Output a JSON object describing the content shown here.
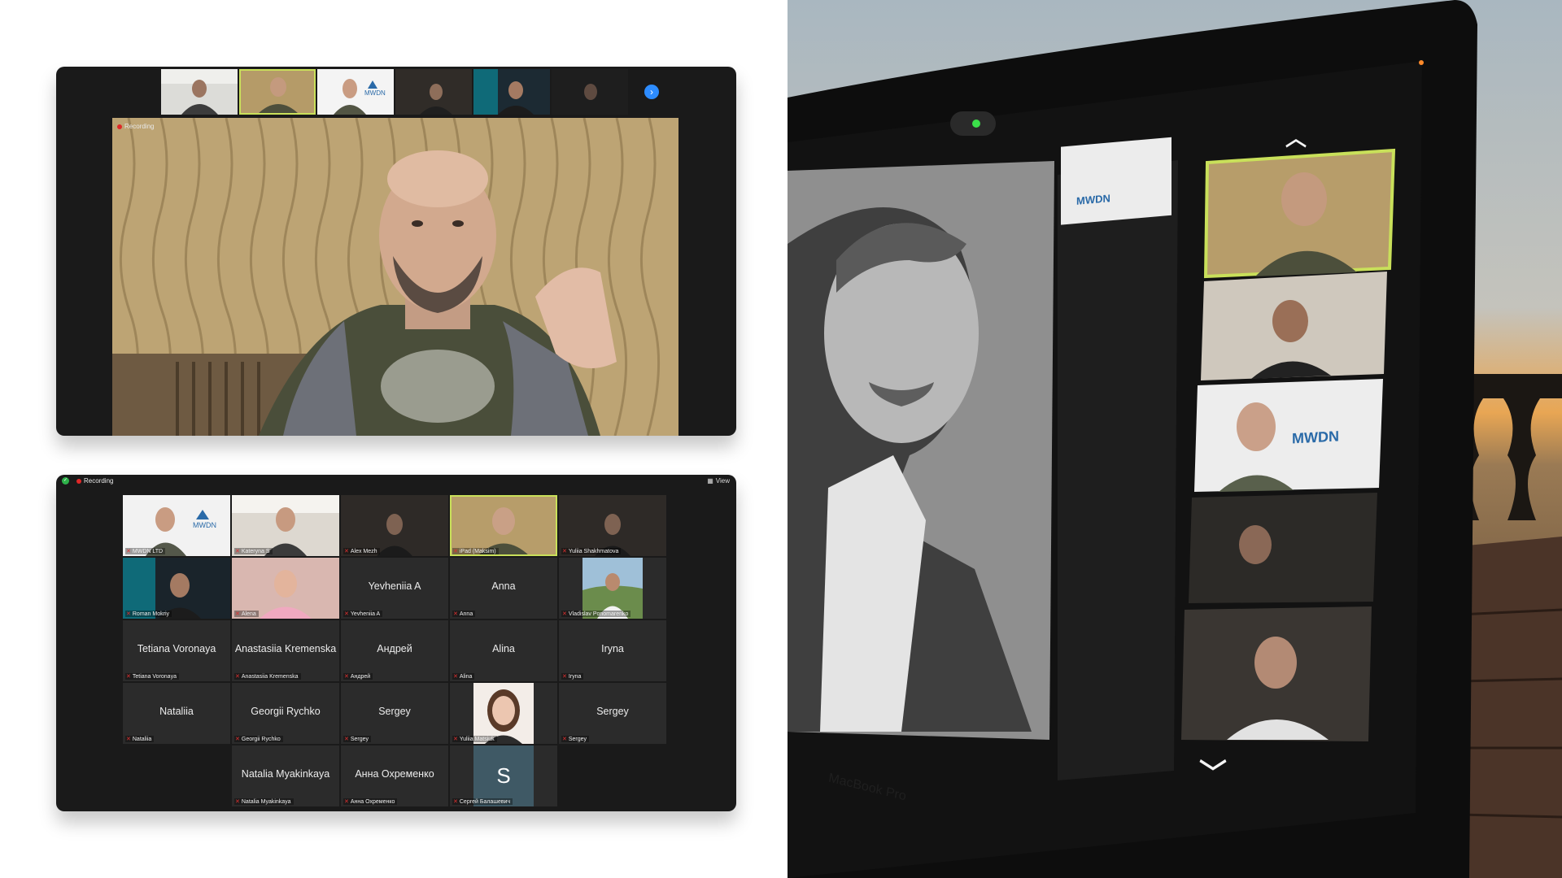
{
  "top_window": {
    "recording_label": "Recording",
    "next_icon": "chevron-right-icon",
    "strip_count": 6
  },
  "bottom_window": {
    "recording_label": "Recording",
    "view_label": "View",
    "tiles": [
      {
        "kind": "video",
        "small": "MWDN LTD",
        "scene": "office-mwdn"
      },
      {
        "kind": "video",
        "small": "Kateryna S",
        "scene": "bright-room"
      },
      {
        "kind": "video",
        "small": "Alex Mezh",
        "scene": "dark-room"
      },
      {
        "kind": "video",
        "small": "iPad (Maksim)",
        "scene": "wallpaper",
        "active": true
      },
      {
        "kind": "video",
        "small": "Yuliia Shakhmatova",
        "scene": "dark-room"
      },
      {
        "kind": "video",
        "small": "Roman Mokriy",
        "scene": "headset"
      },
      {
        "kind": "video",
        "small": "Alena",
        "scene": "pink"
      },
      {
        "kind": "name",
        "big": "Yevheniia A",
        "small": "Yevheniia A"
      },
      {
        "kind": "name",
        "big": "Anna",
        "small": "Anna"
      },
      {
        "kind": "photo",
        "small": "Vladislav Ponomarenko",
        "scene": "outdoor"
      },
      {
        "kind": "name",
        "big": "Tetiana Voronaya",
        "small": "Tetiana Voronaya"
      },
      {
        "kind": "name",
        "big": "Anastasiia Kremenska",
        "small": "Anastasiia Kremenska"
      },
      {
        "kind": "name",
        "big": "Андрей",
        "small": "Андрей"
      },
      {
        "kind": "name",
        "big": "Alina",
        "small": "Alina"
      },
      {
        "kind": "name",
        "big": "Iryna",
        "small": "Iryna"
      },
      {
        "kind": "name",
        "big": "Nataliia",
        "small": "Nataliia"
      },
      {
        "kind": "name",
        "big": "Georgii Rychko",
        "small": "Georgii Rychko"
      },
      {
        "kind": "name",
        "big": "Sergey",
        "small": "Sergey"
      },
      {
        "kind": "photo",
        "small": "Yuliia Matsiuk",
        "scene": "portrait"
      },
      {
        "kind": "name",
        "big": "Sergey",
        "small": "Sergey"
      },
      {
        "kind": "empty"
      },
      {
        "kind": "name",
        "big": "Natalia Myakinkaya",
        "small": "Natalia Myakinkaya"
      },
      {
        "kind": "name",
        "big": "Анна Охременко",
        "small": "Анна Охременко"
      },
      {
        "kind": "initial",
        "big": "S",
        "small": "Сергей Балашевич"
      },
      {
        "kind": "empty"
      }
    ]
  },
  "laptop": {
    "brand_text": "MacBook Pro",
    "mwdn_logo_text": "MWDN",
    "up_icon": "chevron-up-icon",
    "down_icon": "chevron-down-icon"
  },
  "colors": {
    "active_border": "#c9e05a",
    "recording": "#e02828",
    "zoom_blue": "#2d8cff"
  }
}
